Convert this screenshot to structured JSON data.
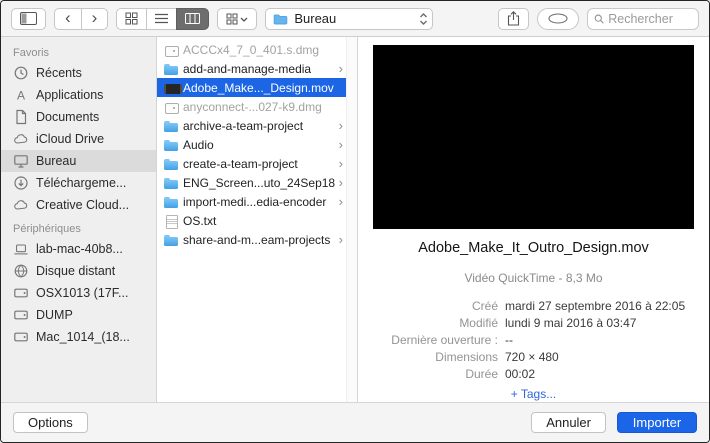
{
  "toolbar": {
    "location": "Bureau",
    "search_placeholder": "Rechercher"
  },
  "sidebar": {
    "sections": [
      {
        "title": "Favoris",
        "items": [
          {
            "id": "recents",
            "label": "Récents",
            "icon": "clock",
            "selected": false
          },
          {
            "id": "applications",
            "label": "Applications",
            "icon": "apps",
            "selected": false
          },
          {
            "id": "documents",
            "label": "Documents",
            "icon": "doc",
            "selected": false
          },
          {
            "id": "icloud-drive",
            "label": "iCloud Drive",
            "icon": "cloud",
            "selected": false
          },
          {
            "id": "bureau",
            "label": "Bureau",
            "icon": "desktop",
            "selected": true
          },
          {
            "id": "telechargements",
            "label": "Téléchargeme...",
            "icon": "download",
            "selected": false
          },
          {
            "id": "creative-cloud",
            "label": "Creative Cloud...",
            "icon": "cloud",
            "selected": false
          }
        ]
      },
      {
        "title": "Périphériques",
        "items": [
          {
            "id": "lab-mac",
            "label": "lab-mac-40b8...",
            "icon": "laptop",
            "selected": false
          },
          {
            "id": "disque-distant",
            "label": "Disque distant",
            "icon": "globe",
            "selected": false
          },
          {
            "id": "osx1013",
            "label": "OSX1013 (17F...",
            "icon": "disk",
            "selected": false
          },
          {
            "id": "dump",
            "label": "DUMP",
            "icon": "disk",
            "selected": false
          },
          {
            "id": "mac-1014",
            "label": "Mac_1014_(18...",
            "icon": "disk",
            "selected": false
          }
        ]
      }
    ]
  },
  "files": {
    "items": [
      {
        "name": "ACCCx4_7_0_401.s.dmg",
        "type": "dmg",
        "disabled": true,
        "selected": false,
        "chevron": false
      },
      {
        "name": "add-and-manage-media",
        "type": "folder",
        "disabled": false,
        "selected": false,
        "chevron": true
      },
      {
        "name": "Adobe_Make..._Design.mov",
        "type": "movie",
        "disabled": false,
        "selected": true,
        "chevron": false
      },
      {
        "name": "anyconnect-...027-k9.dmg",
        "type": "dmg",
        "disabled": true,
        "selected": false,
        "chevron": false
      },
      {
        "name": "archive-a-team-project",
        "type": "folder",
        "disabled": false,
        "selected": false,
        "chevron": true
      },
      {
        "name": "Audio",
        "type": "folder",
        "disabled": false,
        "selected": false,
        "chevron": true
      },
      {
        "name": "create-a-team-project",
        "type": "folder",
        "disabled": false,
        "selected": false,
        "chevron": true
      },
      {
        "name": "ENG_Screen...uto_24Sep18",
        "type": "folder",
        "disabled": false,
        "selected": false,
        "chevron": true
      },
      {
        "name": "import-medi...edia-encoder",
        "type": "folder",
        "disabled": false,
        "selected": false,
        "chevron": true
      },
      {
        "name": "OS.txt",
        "type": "text",
        "disabled": false,
        "selected": false,
        "chevron": false
      },
      {
        "name": "share-and-m...eam-projects",
        "type": "folder",
        "disabled": false,
        "selected": false,
        "chevron": true
      }
    ]
  },
  "preview": {
    "title": "Adobe_Make_It_Outro_Design.mov",
    "subtitle": "Vidéo QuickTime - 8,3 Mo",
    "details": [
      {
        "label": "Créé",
        "value": "mardi 27 septembre 2016 à 22:05"
      },
      {
        "label": "Modifié",
        "value": "lundi 9 mai 2016 à 03:47"
      },
      {
        "label": "Dernière ouverture :",
        "value": "--"
      },
      {
        "label": "Dimensions",
        "value": "720 × 480"
      },
      {
        "label": "Durée",
        "value": "00:02"
      }
    ],
    "tags_link": "+ Tags..."
  },
  "footer": {
    "options_label": "Options",
    "cancel_label": "Annuler",
    "import_label": "Importer"
  },
  "colors": {
    "accent": "#1b66e8",
    "selection": "#1c66e6"
  }
}
